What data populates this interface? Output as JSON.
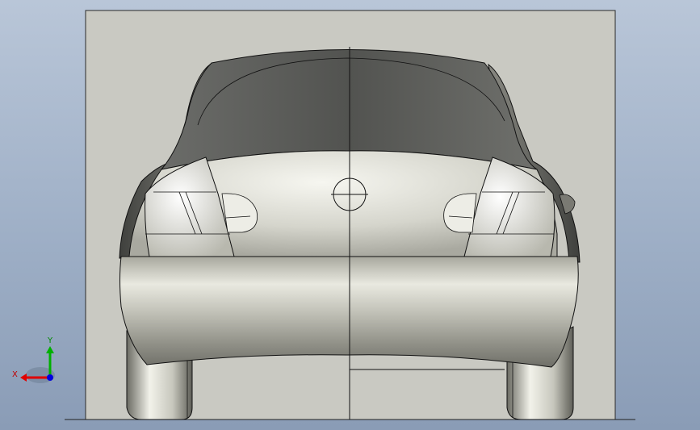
{
  "viewport": {
    "view_name": "Back",
    "background_top": "#b9c6d8",
    "background_bottom": "#8a9cb6"
  },
  "model": {
    "body_color": "#c9c9c0",
    "glass_color": "#5f605d",
    "edge_color": "#000000",
    "sketch_plane_color": "#c9c9c2"
  },
  "triad": {
    "x_label": "X",
    "y_label": "Y",
    "x_color": "#e00000",
    "y_color": "#00b000",
    "z_color": "#0000e0"
  }
}
